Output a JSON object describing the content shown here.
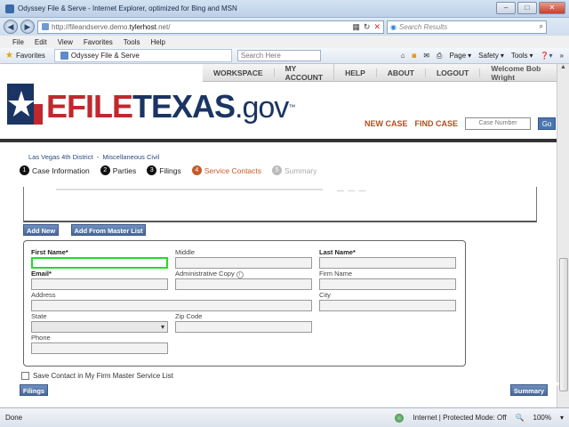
{
  "browser": {
    "title": "Odyssey File & Serve - Internet Explorer, optimized for Bing and MSN",
    "url_prefix": "http://fileandserve.demo.",
    "url_host": "tylerhost",
    "url_suffix": ".net/",
    "search_placeholder": "Search Results",
    "menu": [
      "File",
      "Edit",
      "View",
      "Favorites",
      "Tools",
      "Help"
    ],
    "favorites_label": "Favorites",
    "tab_title": "Odyssey File & Serve",
    "bing_search_placeholder": "Search Here",
    "commands": {
      "page": "Page",
      "safety": "Safety",
      "tools": "Tools"
    },
    "status_left": "Done",
    "status_zone": "Internet | Protected Mode: Off",
    "zoom": "100%"
  },
  "topnav": {
    "items": [
      "WORKSPACE",
      "MY ACCOUNT",
      "HELP",
      "ABOUT",
      "LOGOUT"
    ],
    "welcome": "Welcome Bob Wright"
  },
  "logo": {
    "efile": "EFILE",
    "texas": "TEXAS",
    "gov": ".gov",
    "tm": "™"
  },
  "actions": {
    "new_case": "NEW CASE",
    "find_case": "FIND CASE",
    "case_number_placeholder": "Case Number",
    "go": "Go"
  },
  "breadcrumb": {
    "court": "Las Vegas 4th District",
    "sep": "-",
    "case_type": "Miscellaneous Civil"
  },
  "steps": [
    {
      "num": "1",
      "label": "Case Information"
    },
    {
      "num": "2",
      "label": "Parties"
    },
    {
      "num": "3",
      "label": "Filings"
    },
    {
      "num": "4",
      "label": "Service Contacts"
    },
    {
      "num": "5",
      "label": "Summary"
    }
  ],
  "buttons": {
    "add_new": "Add New",
    "add_from_master": "Add From Master List",
    "filings": "Filings",
    "summary": "Summary"
  },
  "form": {
    "first_name": {
      "label": "First Name*",
      "value": ""
    },
    "middle": {
      "label": "Middle",
      "value": ""
    },
    "last_name": {
      "label": "Last Name*",
      "value": ""
    },
    "email": {
      "label": "Email*",
      "value": ""
    },
    "admin_copy": {
      "label": "Administrative Copy",
      "value": ""
    },
    "firm_name": {
      "label": "Firm Name",
      "value": ""
    },
    "address": {
      "label": "Address",
      "value": ""
    },
    "city": {
      "label": "City",
      "value": ""
    },
    "state": {
      "label": "State",
      "value": ""
    },
    "zip": {
      "label": "Zip Code",
      "value": ""
    },
    "phone": {
      "label": "Phone",
      "value": ""
    },
    "save_contact": "Save Contact in My Firm Master Service List"
  },
  "dashes": "— — —",
  "colors": {
    "accent": "#c55a2a",
    "brand_red": "#c0282d",
    "brand_blue": "#1a3463",
    "focus": "#22dd22"
  }
}
